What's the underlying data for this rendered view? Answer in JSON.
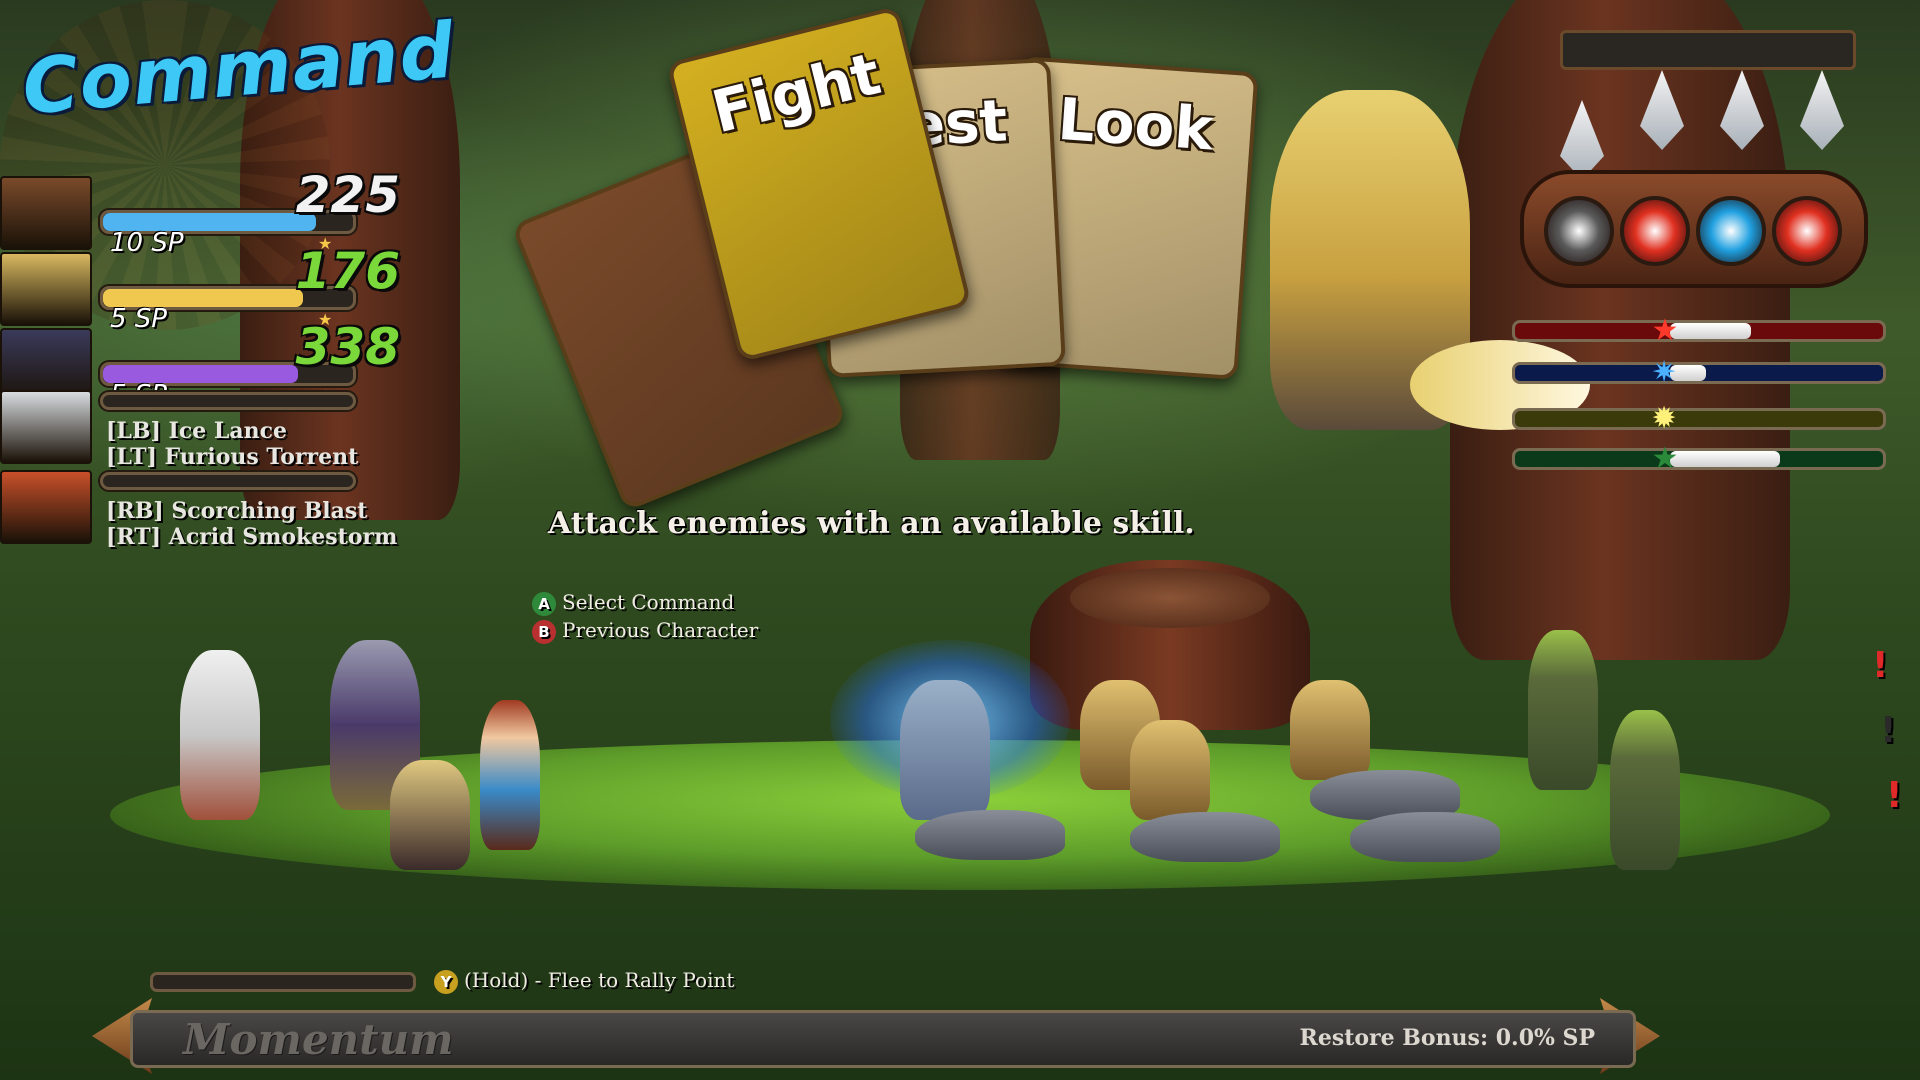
{
  "command": {
    "title": "Command"
  },
  "party": [
    {
      "hp": "225",
      "sp": "10 SP",
      "hp_color": "#f2f2f2",
      "bar_color": "#4fb4f0",
      "bar_fraction": 0.85,
      "portrait_color": "#7a4a2a"
    },
    {
      "hp": "176",
      "sp": "5 SP",
      "hp_color": "#7ad83a",
      "bar_color": "#f0c850",
      "bar_fraction": 0.8,
      "portrait_color": "#d8b860"
    },
    {
      "hp": "338",
      "sp": "5 SP",
      "hp_color": "#7ad83a",
      "bar_color": "#9a5ae0",
      "bar_fraction": 0.78,
      "portrait_color": "#3a3a5a"
    },
    {
      "skills": [
        "[LB] Ice Lance",
        "[LT] Furious Torrent"
      ],
      "portrait_color": "#d8dce0"
    },
    {
      "skills": [
        "[RB] Scorching Blast",
        "[RT] Acrid Smokestorm"
      ],
      "portrait_color": "#c8502a"
    }
  ],
  "cards": [
    {
      "label": "",
      "color": "#7a4a2a"
    },
    {
      "label": "Fight",
      "color": "#d4b020"
    },
    {
      "label": "Rest",
      "color": "#d8c08a"
    },
    {
      "label": "Look",
      "color": "#d8c08a"
    }
  ],
  "hint": "Attack enemies with an available skill.",
  "prompts": [
    {
      "button": "A",
      "text": "Select Command",
      "button_color": "#2e8a3a"
    },
    {
      "button": "B",
      "text": "Previous Character",
      "button_color": "#b83030"
    }
  ],
  "flee": {
    "button": "Y",
    "text": "(Hold) - Flee to Rally Point",
    "button_color": "#c8a020"
  },
  "momentum": {
    "label": "Momentum",
    "restore": "Restore Bonus: 0.0% SP"
  },
  "enemy_orbs": [
    {
      "icon": "paw-icon",
      "color": "#5a5a5a"
    },
    {
      "icon": "fire-orb-icon",
      "color": "#e03020"
    },
    {
      "icon": "ice-orb-icon",
      "color": "#20a0e0"
    },
    {
      "icon": "fire-orb-icon",
      "color": "#e03020"
    }
  ],
  "enemy_bars": [
    {
      "color": "#6a0a0a",
      "icon": "★",
      "icon_color": "#ff3a2a",
      "fraction": 0.22
    },
    {
      "color": "#0a1a4a",
      "icon": "✷",
      "icon_color": "#4ab0ff",
      "fraction": 0.1
    },
    {
      "color": "#3a3a0a",
      "icon": "✹",
      "icon_color": "#fff07a",
      "fraction": 0.0
    },
    {
      "color": "#0a3a1a",
      "icon": "★",
      "icon_color": "#2a8a3a",
      "fraction": 0.3
    }
  ],
  "alerts": [
    {
      "text": "!",
      "color": "#e02a2a"
    },
    {
      "text": "!",
      "color": "#2a2a2a"
    },
    {
      "text": "!",
      "color": "#e02a2a"
    }
  ]
}
